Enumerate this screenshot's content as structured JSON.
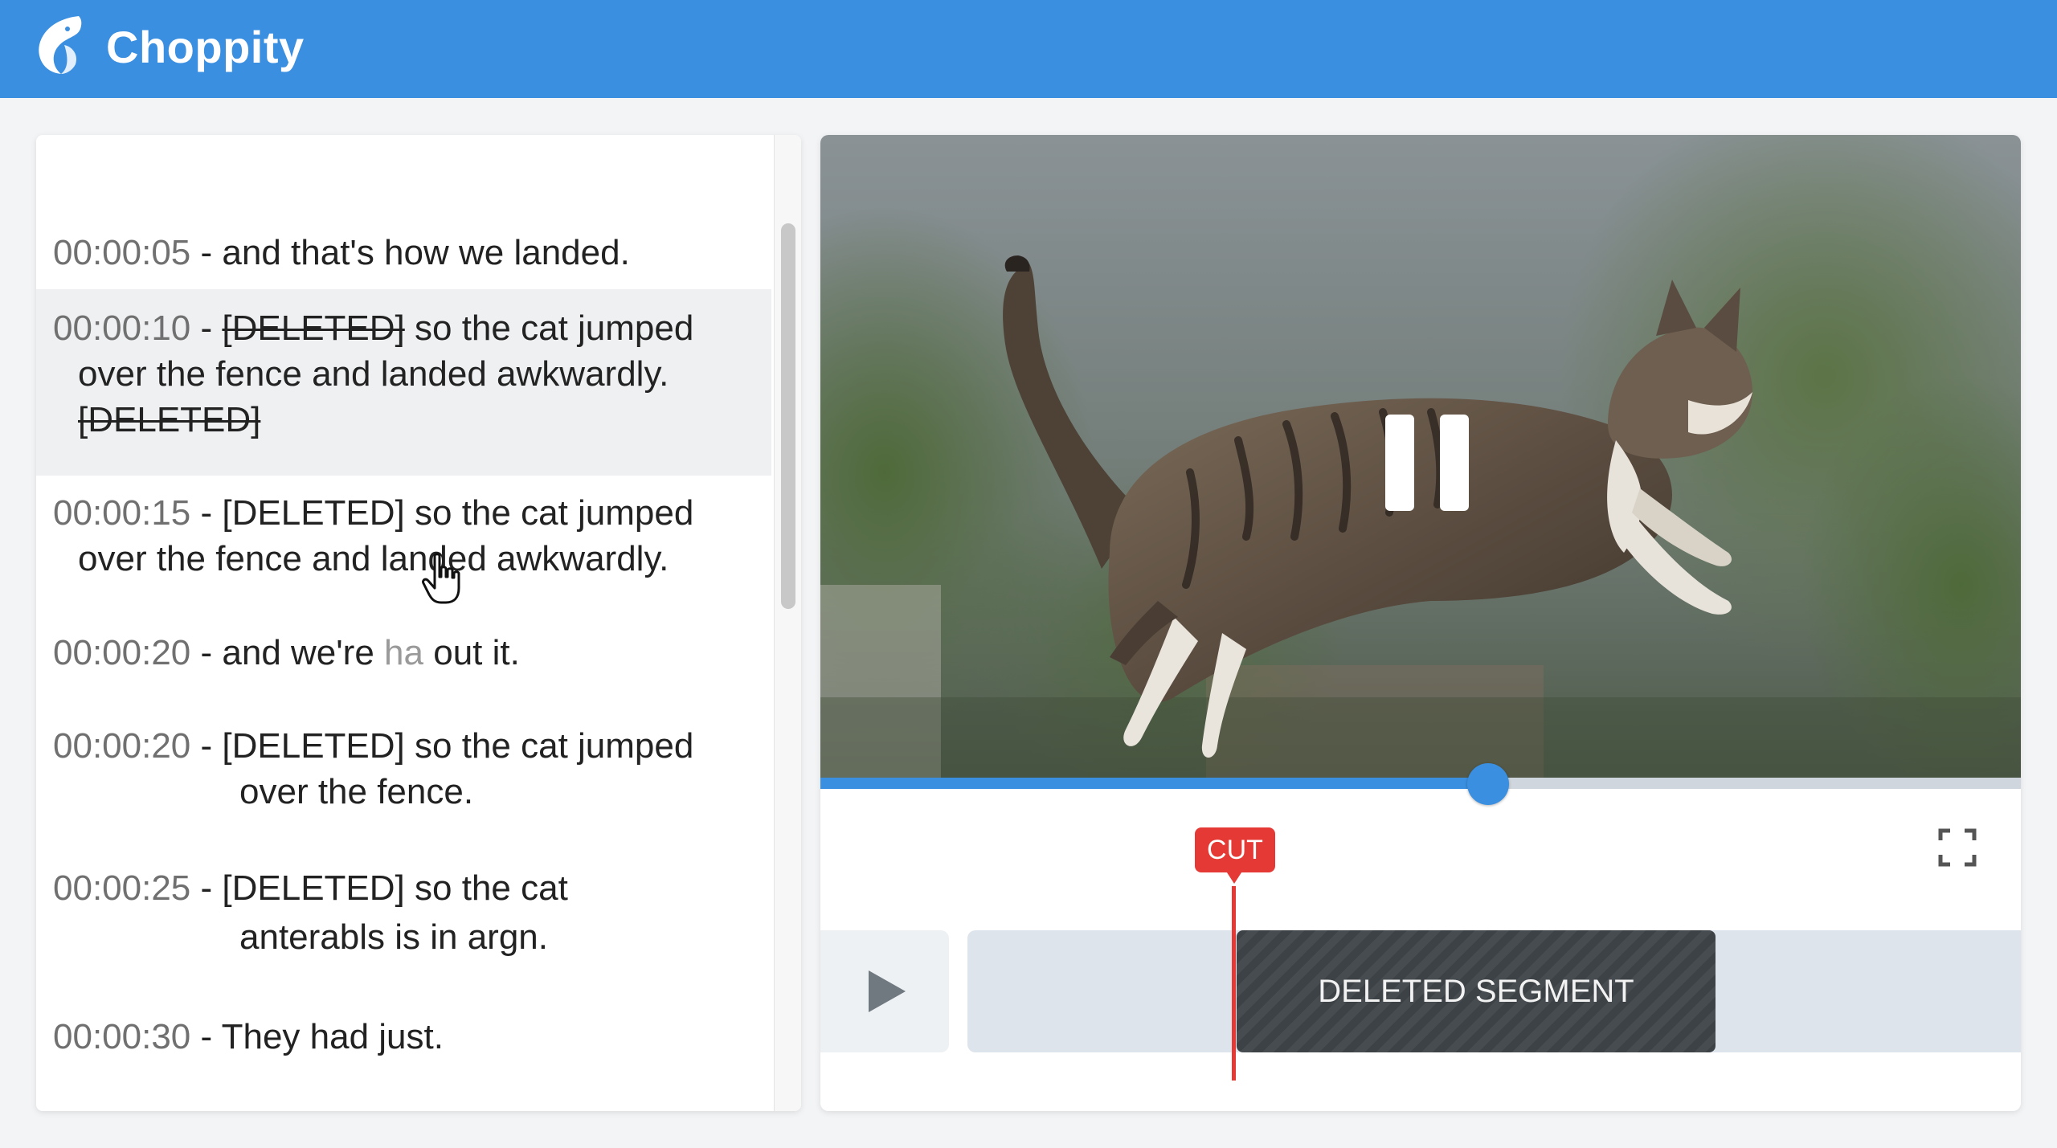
{
  "app": {
    "brand": "Choppity",
    "brand_color": "#3a8fe1"
  },
  "transcript": {
    "entries": [
      {
        "timestamp": "00:00:05",
        "lines": [
          "and that's how we landed."
        ]
      },
      {
        "timestamp": "00:00:10",
        "lines": [
          "[DELETED]",
          "so the cat jumped",
          "over the fence and landed awkwardly.",
          "[DELETED]"
        ]
      },
      {
        "timestamp": "00:00:15",
        "lines": [
          "[DELETED] so the cat jumped",
          "over the fence and landed awkwardly."
        ]
      },
      {
        "timestamp": "00:00:20",
        "lines": [
          "and we're",
          "ha",
          "out it."
        ]
      },
      {
        "timestamp": "00:00:20",
        "lines": [
          "[DELETED] so the cat jumped",
          "over the fence."
        ]
      },
      {
        "timestamp": "00:00:25",
        "lines": [
          "[DELETED] so the cat",
          "anterabls is in argn."
        ]
      },
      {
        "timestamp": "00:00:30",
        "lines": [
          "They had just."
        ]
      }
    ],
    "separator": " - "
  },
  "player": {
    "state": "paused",
    "progress_fraction": 0.556,
    "cut_marker_label": "CUT",
    "deleted_segment_label": "DELETED SEGMENT",
    "cut_color": "#e53935",
    "icons": [
      "pause-icon",
      "play-icon",
      "fullscreen-icon",
      "hand-pointer-icon"
    ]
  }
}
